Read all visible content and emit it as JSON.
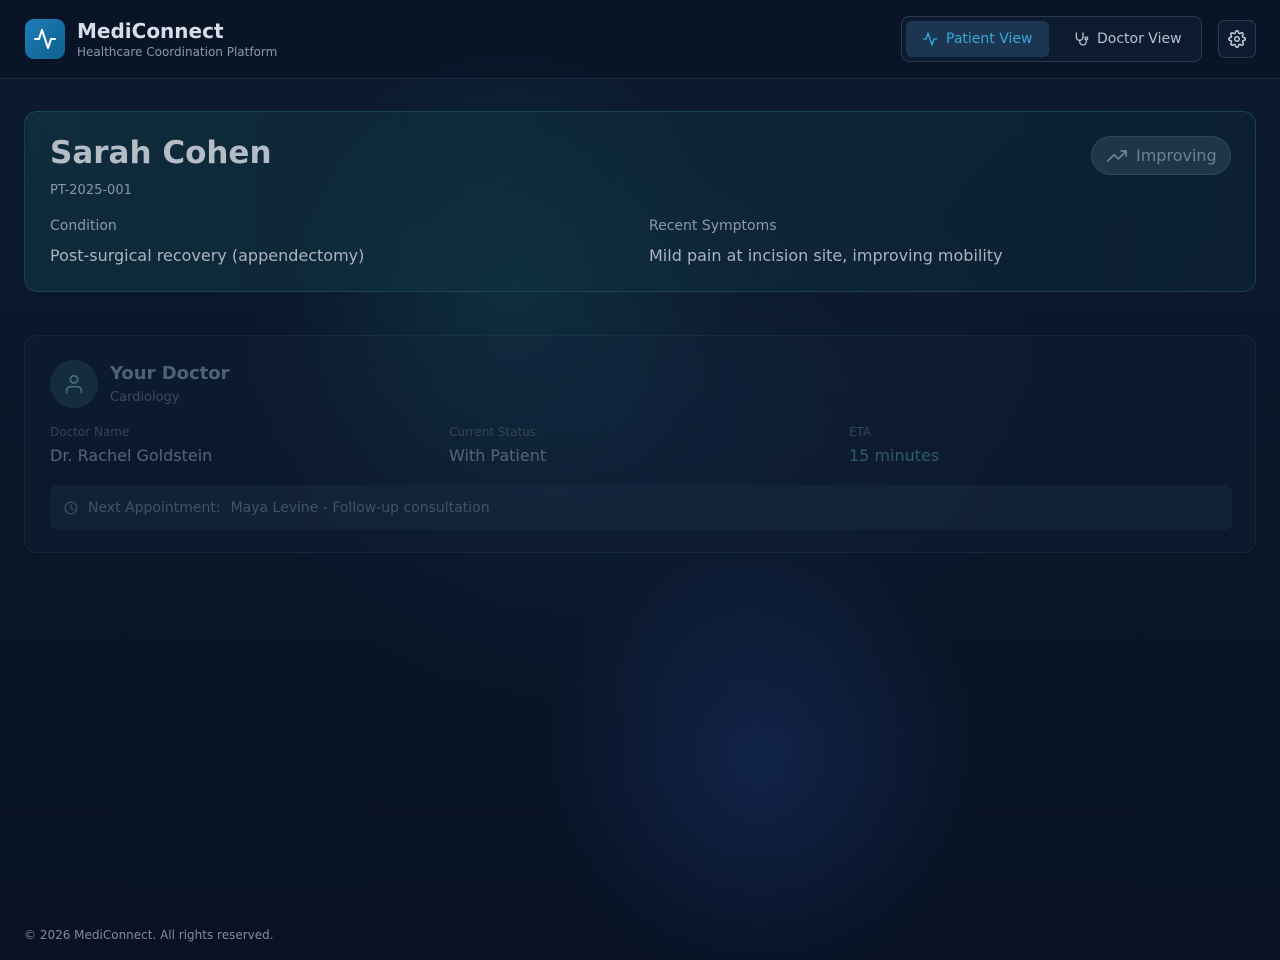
{
  "app": {
    "title": "MediConnect",
    "subtitle": "Healthcare Coordination Platform"
  },
  "header": {
    "views": [
      {
        "label": "Patient View",
        "icon": "activity-icon",
        "active": true
      },
      {
        "label": "Doctor View",
        "icon": "stethoscope-icon",
        "active": false
      }
    ],
    "settings_icon": "gear-icon"
  },
  "patient": {
    "name": "Sarah Cohen",
    "id": "PT-2025-001",
    "status": "Improving",
    "condition_label": "Condition",
    "condition": "Post-surgical recovery (appendectomy)",
    "symptoms_label": "Recent Symptoms",
    "symptoms": "Mild pain at incision site, improving mobility"
  },
  "doctor_card": {
    "heading": "Your Doctor",
    "specialty": "Cardiology",
    "name_label": "Doctor Name",
    "name": "Dr. Rachel Goldstein",
    "status_label": "Current Status",
    "status": "With Patient",
    "eta_label": "ETA",
    "eta": "15 minutes",
    "next_appointment_label": "Next Appointment:",
    "next_appointment": "Maya Levine - Follow-up consultation"
  },
  "footer": {
    "copyright": "© 2026 MediConnect. All rights reserved."
  },
  "colors": {
    "accent": "#38a6d8",
    "logo_bg": "#1e7fb8",
    "background": "#0a1628"
  }
}
